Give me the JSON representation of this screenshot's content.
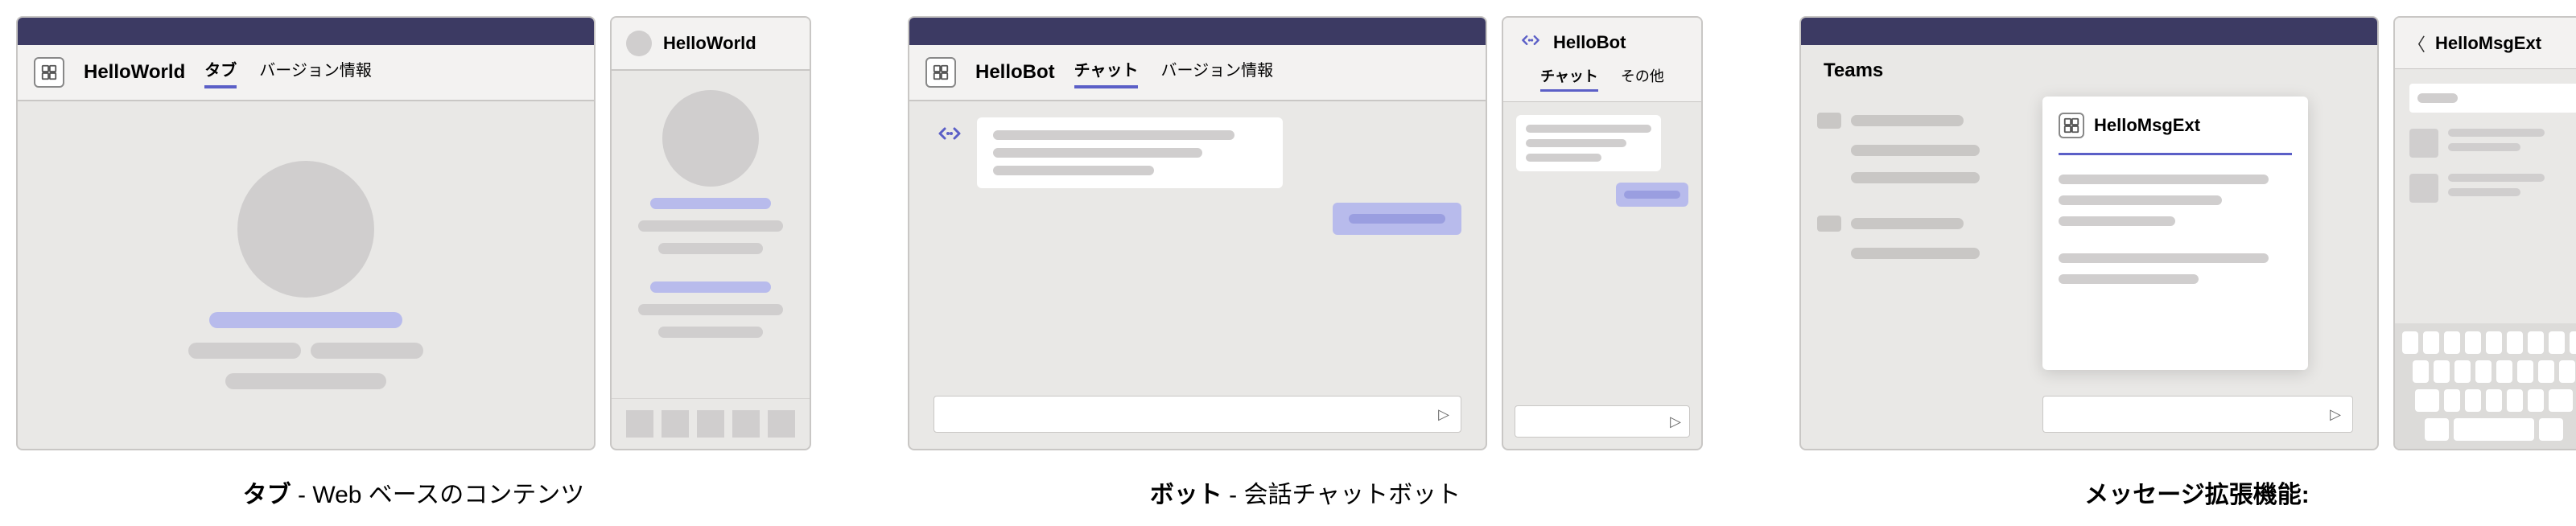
{
  "sections": {
    "tab": {
      "desktop": {
        "app_name": "HelloWorld",
        "tab_active": "タブ",
        "tab_other": "バージョン情報"
      },
      "mobile": {
        "app_name": "HelloWorld"
      },
      "caption_bold": "タブ",
      "caption_rest": " - Web ベースのコンテンツ"
    },
    "bot": {
      "desktop": {
        "app_name": "HelloBot",
        "tab_active": "チャット",
        "tab_other": "バージョン情報"
      },
      "mobile": {
        "app_name": "HelloBot",
        "tab_active": "チャット",
        "tab_other": "その他"
      },
      "caption_bold": "ボット",
      "caption_rest": " - 会話チャットボット"
    },
    "ext": {
      "desktop": {
        "header": "Teams",
        "card_title": "HelloMsgExt"
      },
      "mobile": {
        "title": "HelloMsgExt"
      },
      "caption_bold": "メッセージ拡張機能:"
    }
  },
  "icons": {
    "bot_color": "#5b5fc7"
  }
}
